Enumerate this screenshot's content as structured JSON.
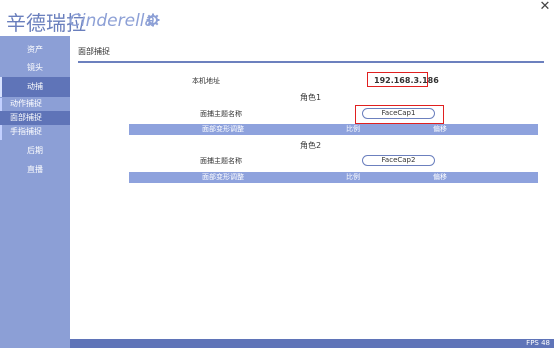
{
  "header": {
    "logo_cn": "辛德瑞拉",
    "logo_en": "Cinderella",
    "icons": {
      "settings": "gear-icon",
      "close": "close-icon"
    }
  },
  "sidebar": {
    "items": [
      {
        "label": "资产"
      },
      {
        "label": "镜头"
      },
      {
        "label": "动捕"
      },
      {
        "label": "后期"
      },
      {
        "label": "直播"
      }
    ],
    "subitems": [
      {
        "label": "动作捕捉"
      },
      {
        "label": "面部捕捉"
      },
      {
        "label": "手指捕捉"
      }
    ],
    "active_item": "动捕",
    "active_subitem": "面部捕捉"
  },
  "main": {
    "title": "面部捕捉",
    "local_address_label": "本机地址",
    "local_address_value": "192.168.3.186",
    "roles": [
      {
        "name": "角色1",
        "subject_label": "面捕主题名称",
        "subject_value": "FaceCap1",
        "table_headers": [
          "面部变形调整",
          "比例",
          "偏移"
        ]
      },
      {
        "name": "角色2",
        "subject_label": "面捕主题名称",
        "subject_value": "FaceCap2",
        "table_headers": [
          "面部变形调整",
          "比例",
          "偏移"
        ]
      }
    ]
  },
  "footer": {
    "fps": "FPS 48"
  },
  "colors": {
    "sidebar": "#8c9fd6",
    "sidebar_active": "#5f74b8",
    "accent": "#6c80be",
    "table_header": "#8ea2dd",
    "highlight_box": "#e02020"
  }
}
